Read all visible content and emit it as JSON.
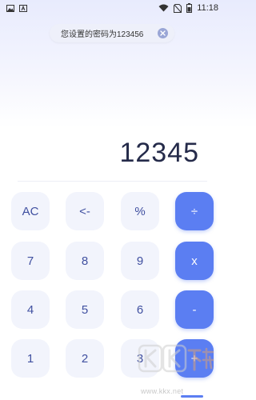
{
  "status_bar": {
    "time": "11:18",
    "left_icons": [
      "image-icon",
      "font-icon"
    ],
    "right_icons": [
      "wifi-icon",
      "no-sim-icon",
      "battery-icon"
    ]
  },
  "toast": {
    "message": "您设置的密码为123456"
  },
  "display": {
    "value": "12345"
  },
  "keys": [
    {
      "label": "AC",
      "type": "function"
    },
    {
      "label": "<-",
      "type": "function"
    },
    {
      "label": "%",
      "type": "function"
    },
    {
      "label": "÷",
      "type": "operator"
    },
    {
      "label": "7",
      "type": "digit"
    },
    {
      "label": "8",
      "type": "digit"
    },
    {
      "label": "9",
      "type": "digit"
    },
    {
      "label": "x",
      "type": "operator"
    },
    {
      "label": "4",
      "type": "digit"
    },
    {
      "label": "5",
      "type": "digit"
    },
    {
      "label": "6",
      "type": "digit"
    },
    {
      "label": "-",
      "type": "operator"
    },
    {
      "label": "1",
      "type": "digit"
    },
    {
      "label": "2",
      "type": "digit"
    },
    {
      "label": "3",
      "type": "digit"
    },
    {
      "label": "+",
      "type": "operator"
    }
  ],
  "watermark": {
    "logo_text": "KK下载",
    "url": "www.kkx.net"
  },
  "colors": {
    "accent": "#5b7ef2",
    "key_bg": "#f2f4fc",
    "key_text": "#4050a0",
    "display_text": "#252b4a"
  }
}
